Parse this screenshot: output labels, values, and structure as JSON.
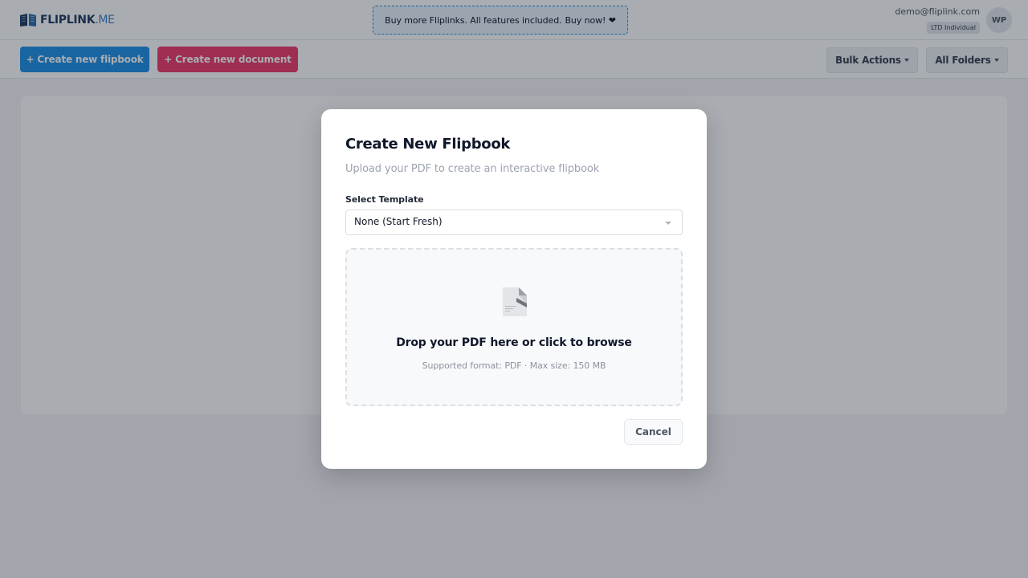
{
  "header": {
    "logo_brand": "FLIPLINK",
    "logo_tld": ".ME",
    "promo_text": "Buy more Fliplinks. All features included.",
    "promo_cta": "Buy now! ❤",
    "user_email": "demo@fliplink.com",
    "user_plan": "LTD Individual",
    "avatar_initials": "WP"
  },
  "toolbar": {
    "create_flipbook": "+ Create new flipbook",
    "create_document": "+ Create new document",
    "bulk_actions": "Bulk Actions",
    "all_folders": "All Folders"
  },
  "modal": {
    "title": "Create New Flipbook",
    "subtitle": "Upload your PDF to create an interactive flipbook",
    "template_label": "Select Template",
    "template_value": "None (Start Fresh)",
    "drop_title": "Drop your PDF here or click to browse",
    "drop_hint": "Supported format: PDF · Max size: 150 MB",
    "cancel_label": "Cancel"
  },
  "colors": {
    "primary_blue": "#1e90e8",
    "accent_pink": "#ee3b6b",
    "overlay": "rgba(17,24,39,0.36)"
  },
  "icons": {
    "logo": "book-icon",
    "select_caret": "chevron-down-icon",
    "upload": "file-icon"
  }
}
